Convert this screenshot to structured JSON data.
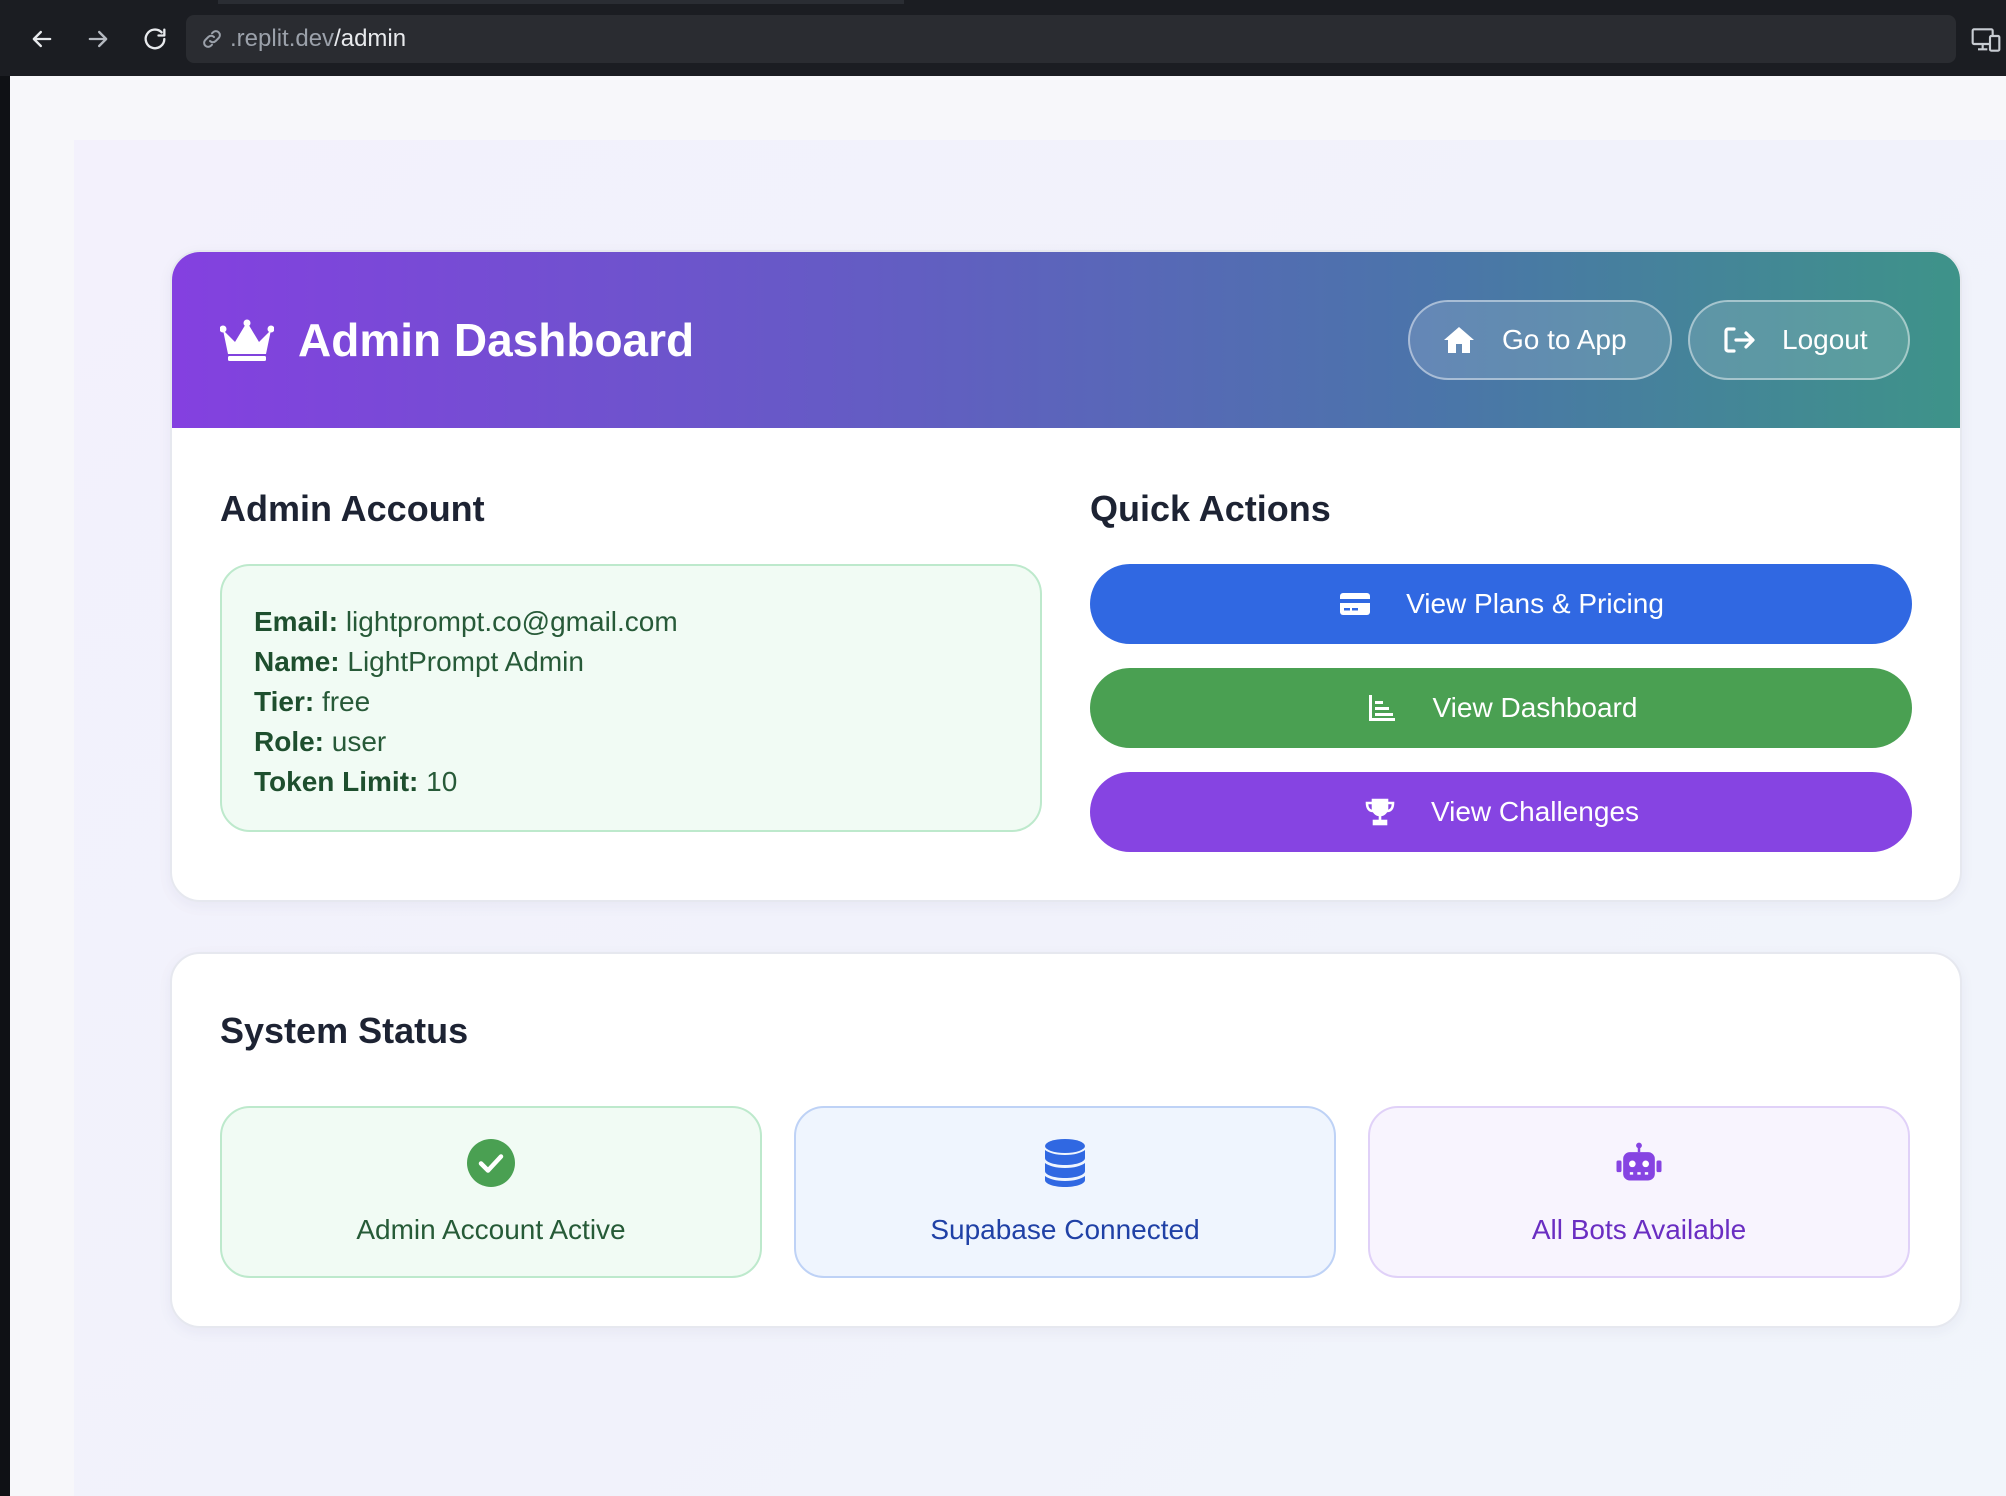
{
  "browser": {
    "url_host": ".replit.dev",
    "url_path": "/admin",
    "icons": [
      "back-arrow-icon",
      "forward-arrow-icon",
      "reload-icon",
      "link-icon",
      "devices-icon"
    ]
  },
  "header": {
    "title": "Admin Dashboard",
    "icon": "crown-icon",
    "go_to_app_label": "Go to App",
    "logout_label": "Logout",
    "gradient_colors": [
      "#8440e0",
      "#3e9389"
    ]
  },
  "account": {
    "heading": "Admin Account",
    "fields": [
      {
        "key": "Email:",
        "value": "lightprompt.co@gmail.com"
      },
      {
        "key": "Name:",
        "value": "LightPrompt Admin"
      },
      {
        "key": "Tier:",
        "value": "free"
      },
      {
        "key": "Role:",
        "value": "user"
      },
      {
        "key": "Token Limit:",
        "value": "10"
      }
    ]
  },
  "quick_actions": {
    "heading": "Quick Actions",
    "buttons": [
      {
        "label": "View Plans & Pricing",
        "icon": "credit-card-icon",
        "color": "#3068e2"
      },
      {
        "label": "View Dashboard",
        "icon": "bar-chart-icon",
        "color": "#4aa052"
      },
      {
        "label": "View Challenges",
        "icon": "trophy-icon",
        "color": "#8644e2"
      }
    ]
  },
  "system_status": {
    "heading": "System Status",
    "items": [
      {
        "label": "Admin Account Active",
        "icon": "check-circle-icon",
        "color": "#4aa052"
      },
      {
        "label": "Supabase Connected",
        "icon": "database-icon",
        "color": "#3068e2"
      },
      {
        "label": "All Bots Available",
        "icon": "robot-icon",
        "color": "#8644e2"
      }
    ]
  }
}
